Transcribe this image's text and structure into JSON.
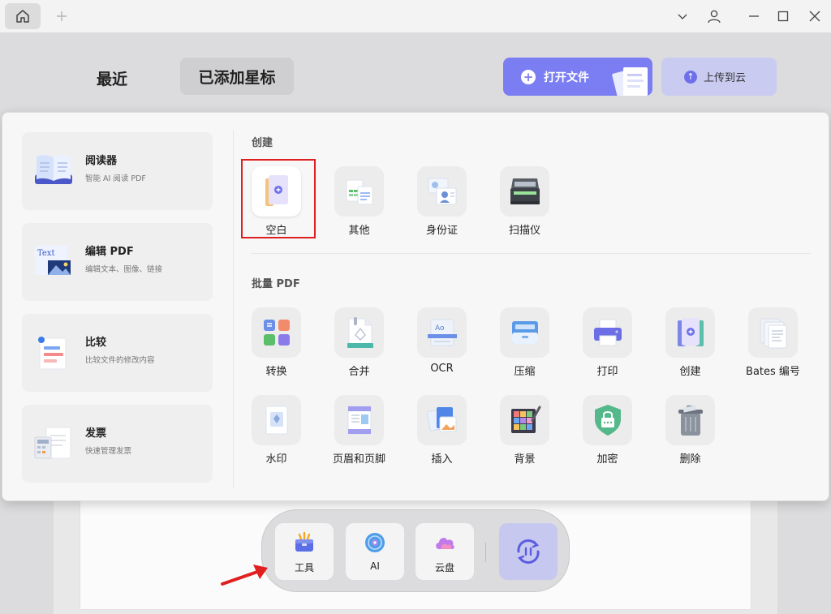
{
  "titlebar": {
    "home_icon": "home-icon",
    "new_tab_icon": "plus-icon",
    "controls": [
      "chevron-down-icon",
      "user-icon",
      "minimize-icon",
      "maximize-icon",
      "close-icon"
    ]
  },
  "header": {
    "tabs": [
      {
        "label": "最近",
        "active": false
      },
      {
        "label": "已添加星标",
        "active": true
      }
    ],
    "open_file_label": "打开文件",
    "upload_label": "上传到云",
    "accent": "#7b7ef2"
  },
  "features": [
    {
      "title": "阅读器",
      "desc": "智能 AI 阅读 PDF",
      "icon": "book-icon"
    },
    {
      "title": "编辑 PDF",
      "desc": "编辑文本、图像、链接",
      "icon": "edit-text-icon",
      "icon_text": "Text"
    },
    {
      "title": "比较",
      "desc": "比较文件的修改内容",
      "icon": "compare-icon"
    },
    {
      "title": "发票",
      "desc": "快速管理发票",
      "icon": "invoice-icon"
    }
  ],
  "create": {
    "title": "创建",
    "tools": [
      {
        "label": "空白",
        "icon": "blank-doc-icon",
        "selected": true
      },
      {
        "label": "其他",
        "icon": "other-doc-icon"
      },
      {
        "label": "身份证",
        "icon": "id-card-icon"
      },
      {
        "label": "扫描仪",
        "icon": "scanner-icon"
      }
    ]
  },
  "batch": {
    "title": "批量 PDF",
    "row1": [
      {
        "label": "转换",
        "icon": "convert-icon"
      },
      {
        "label": "合并",
        "icon": "merge-icon"
      },
      {
        "label": "OCR",
        "icon": "ocr-icon",
        "icon_text": "Ao"
      },
      {
        "label": "压缩",
        "icon": "compress-icon"
      },
      {
        "label": "打印",
        "icon": "print-icon"
      },
      {
        "label": "创建",
        "icon": "create-icon"
      },
      {
        "label": "Bates 编号",
        "icon": "bates-icon"
      }
    ],
    "row2": [
      {
        "label": "水印",
        "icon": "watermark-icon"
      },
      {
        "label": "页眉和页脚",
        "icon": "header-footer-icon"
      },
      {
        "label": "插入",
        "icon": "insert-icon"
      },
      {
        "label": "背景",
        "icon": "background-icon"
      },
      {
        "label": "加密",
        "icon": "encrypt-icon"
      },
      {
        "label": "删除",
        "icon": "delete-icon"
      }
    ]
  },
  "dock": {
    "items": [
      {
        "label": "工具",
        "icon": "toolbox-icon"
      },
      {
        "label": "AI",
        "icon": "ai-icon"
      },
      {
        "label": "云盘",
        "icon": "cloud-icon"
      }
    ],
    "sync_icon": "sync-icon"
  },
  "annotation": {
    "highlight_color": "#e02020",
    "arrow_color": "#e02020"
  }
}
